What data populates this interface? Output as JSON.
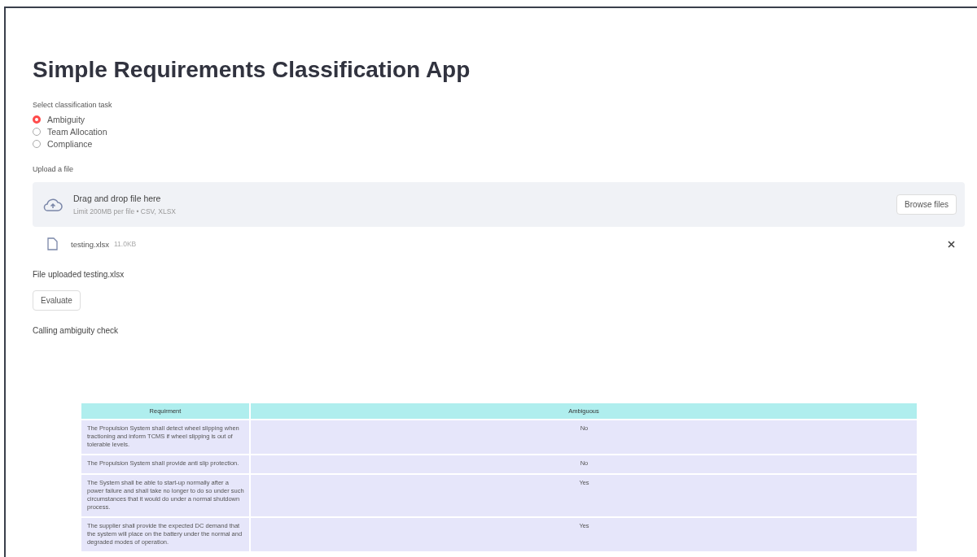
{
  "title": "Simple Requirements Classification App",
  "task": {
    "label": "Select classification task",
    "options": [
      {
        "label": "Ambiguity",
        "selected": true
      },
      {
        "label": "Team Allocation",
        "selected": false
      },
      {
        "label": "Compliance",
        "selected": false
      }
    ]
  },
  "upload": {
    "label": "Upload a file",
    "drop_text": "Drag and drop file here",
    "limit_text": "Limit 200MB per file • CSV, XLSX",
    "browse_button": "Browse files",
    "file": {
      "name": "testing.xlsx",
      "size": "11.0KB"
    }
  },
  "status": "File uploaded testing.xlsx",
  "evaluate_button": "Evaluate",
  "message": "Calling ambiguity check",
  "table": {
    "columns": [
      "Requirment",
      "Ambiguous"
    ],
    "rows": [
      {
        "requirement": "The Propulsion System shall detect wheel slipping when tractioning and inform TCMS if wheel slipping is out of tolerable levels.",
        "ambiguous": "No"
      },
      {
        "requirement": "The Propulsion System shall provide anti slip protection.",
        "ambiguous": "No"
      },
      {
        "requirement": "The System shall be able to start-up normally after a power failure and shall take no longer to do so under such circumstances that it would do under a normal shutdown process.",
        "ambiguous": "Yes"
      },
      {
        "requirement": "The supplier shall provide the expected DC demand that the system will place on the battery under the normal and degraded modes of operation.",
        "ambiguous": "Yes"
      }
    ]
  }
}
